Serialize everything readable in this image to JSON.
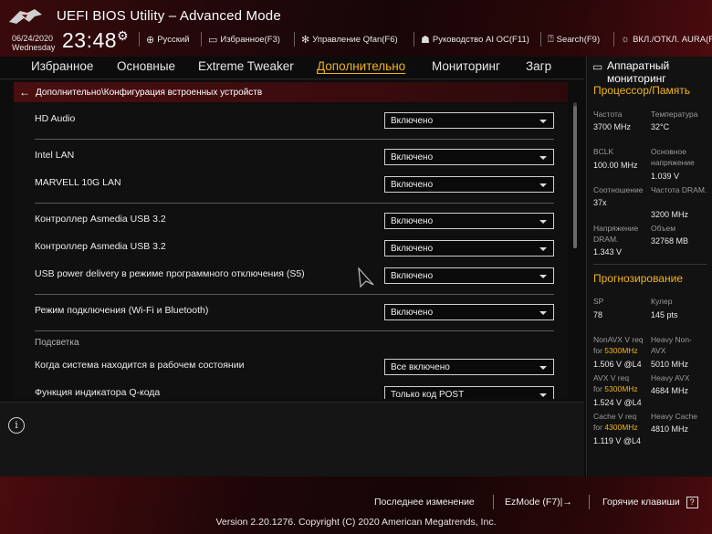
{
  "header": {
    "title": "UEFI BIOS Utility – Advanced Mode",
    "date": "06/24/2020",
    "weekday": "Wednesday",
    "time": "23:48",
    "buttons": {
      "language": "Русский",
      "favorites": "Избранное(F3)",
      "qfan": "Управление Qfan(F6)",
      "ai_oc": "Руководство AI OC(F11)",
      "search": "Search(F9)",
      "aura": "ВКЛ./ОТКЛ. AURA(F4)"
    }
  },
  "tabs": [
    "Избранное",
    "Основные",
    "Extreme Tweaker",
    "Дополнительно",
    "Мониторинг",
    "Загр"
  ],
  "active_tab": "Дополнительно",
  "breadcrumb": "Дополнительно\\Конфигурация встроенных устройств",
  "settings": [
    {
      "label": "HD Audio",
      "value": "Включено"
    },
    {
      "label": "Intel LAN",
      "value": "Включено"
    },
    {
      "label": "MARVELL 10G LAN",
      "value": "Включено"
    },
    {
      "label": "Контроллер Asmedia USB 3.2",
      "value": "Включено"
    },
    {
      "label": "Контроллер Asmedia USB 3.2",
      "value": "Включено"
    },
    {
      "label": "USB power delivery в режиме программного отключения (S5)",
      "value": "Включено"
    },
    {
      "label": "Режим подключения (Wi-Fi и Bluetooth)",
      "value": "Включено"
    },
    {
      "section": "Подсветка"
    },
    {
      "label": "Когда система находится в рабочем состоянии",
      "value": "Все включено"
    },
    {
      "label": "Функция индикатора Q-кода",
      "value": "Только код POST"
    }
  ],
  "hw_monitor": {
    "title": "Аппаратный мониторинг",
    "cpu_section": "Процессор/Память",
    "cpu": {
      "freq_label": "Частота",
      "freq_value": "3700 MHz",
      "temp_label": "Температура",
      "temp_value": "32°C",
      "bclk_label": "BCLK",
      "bclk_value": "100.00 MHz",
      "core_v_label": "Основное напряжение",
      "core_v_value": "1.039 V",
      "ratio_label": "Соотношение",
      "ratio_value": "37x",
      "dram_freq_label": "Частота DRAM.",
      "dram_freq_value": "3200 MHz",
      "dram_v_label": "Напряжение DRAM.",
      "dram_v_value": "1.343 V",
      "capacity_label": "Объем",
      "capacity_value": "32768 MB"
    },
    "forecast_section": "Прогнозирование",
    "forecast": {
      "sp_label": "SP",
      "sp_value": "78",
      "cooler_label": "Кулер",
      "cooler_value": "145 pts",
      "nonavx_label": "NonAVX V req",
      "nonavx_for": "for",
      "nonavx_freq": "5300MHz",
      "nonavx_value": "1.506 V @L4",
      "heavy_nonavx_label": "Heavy Non-AVX",
      "heavy_nonavx_value": "5010 MHz",
      "avx_label": "AVX V req",
      "avx_for": "for",
      "avx_freq": "5300MHz",
      "avx_value": "1.524 V @L4",
      "heavy_avx_label": "Heavy AVX",
      "heavy_avx_value": "4684 MHz",
      "cache_label": "Cache V req",
      "cache_for": "for",
      "cache_freq": "4300MHz",
      "cache_value": "1.119 V @L4",
      "heavy_cache_label": "Heavy Cache",
      "heavy_cache_value": "4810 MHz"
    }
  },
  "footer": {
    "last_change": "Последнее изменение",
    "ezmode": "EzMode (F7)|→",
    "hotkeys": "Горячие клавиши",
    "hotkeys_icon": "?",
    "version": "Version 2.20.1276. Copyright (C) 2020 American Megatrends, Inc."
  },
  "colors": {
    "accent": "#f2b41b",
    "header_red": "#3a0a0c",
    "breadcrumb_red": "#4a0e10"
  },
  "icons": [
    "rog-logo",
    "gear-icon",
    "globe-icon",
    "favorites-icon",
    "fan-icon",
    "ai-oc-icon",
    "search-icon",
    "aura-icon",
    "monitor-icon",
    "info-icon",
    "back-arrow-icon",
    "mouse-cursor-icon",
    "ezmode-icon",
    "hotkeys-icon"
  ]
}
